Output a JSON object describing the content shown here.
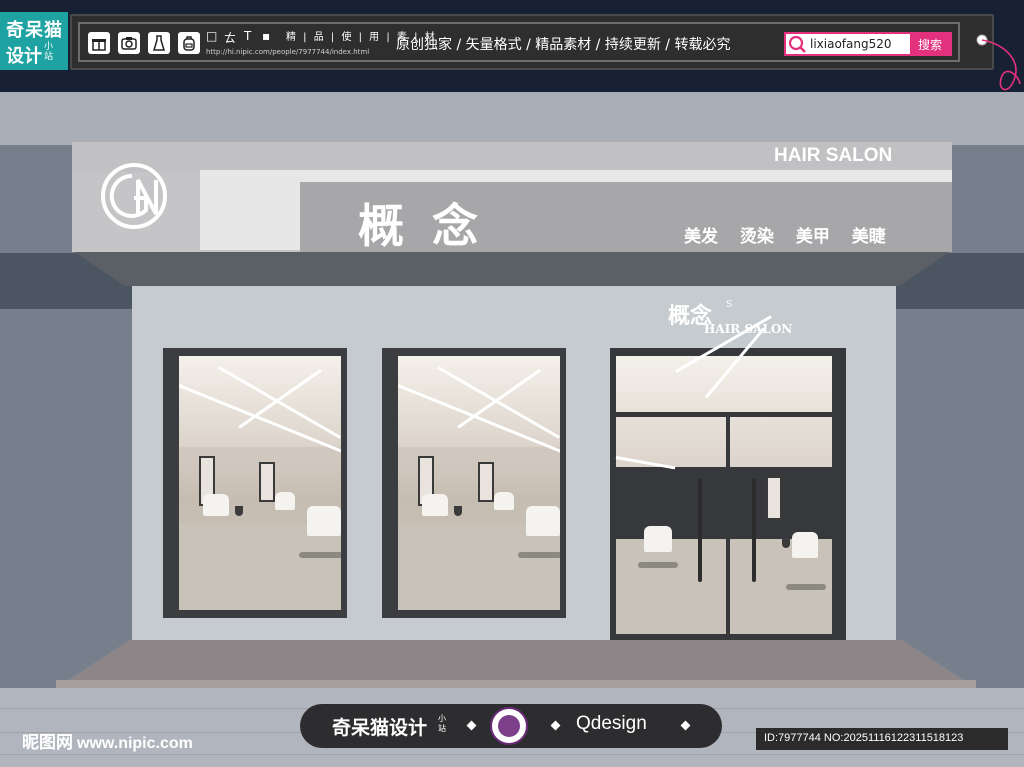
{
  "brand": {
    "line1": "奇呆猫",
    "line2": "设计",
    "line3": "小站"
  },
  "toolbar": {
    "icons": [
      "gift-icon",
      "camera-icon",
      "dress-icon",
      "backpack-icon"
    ],
    "tools": [
      "□",
      "ㄊ",
      "T",
      "▪"
    ],
    "tags": "精 | 品 | 使 | 用 | 素 | 材",
    "url": "http://hi.nipic.com/people/7977744/index.html",
    "slogan": "原创独家 / 矢量格式 / 精品素材 / 持续更新 / 转载必究"
  },
  "search": {
    "value": "lixiaofang520",
    "button_label": "搜索"
  },
  "sign": {
    "hair_salon": "HAIR SALON",
    "name": "概念",
    "services": [
      "美发",
      "烫染",
      "美甲",
      "美睫"
    ],
    "logo_letters": "GN"
  },
  "small_logo": {
    "cn": "概念",
    "sup": "S",
    "en": "HAIR SALON"
  },
  "watermark": {
    "text": "奇呆猫设计",
    "small": "小站",
    "seal_text": "奇呆猫设计",
    "qdesign": "Qdesign"
  },
  "footer": {
    "site_cn": "昵图网",
    "site_url": "www.nipic.com",
    "id_text": "ID:7977744 NO:20251116122311518123"
  },
  "colors": {
    "brand_teal": "#1fa3a2",
    "search_pink": "#e3317d"
  }
}
